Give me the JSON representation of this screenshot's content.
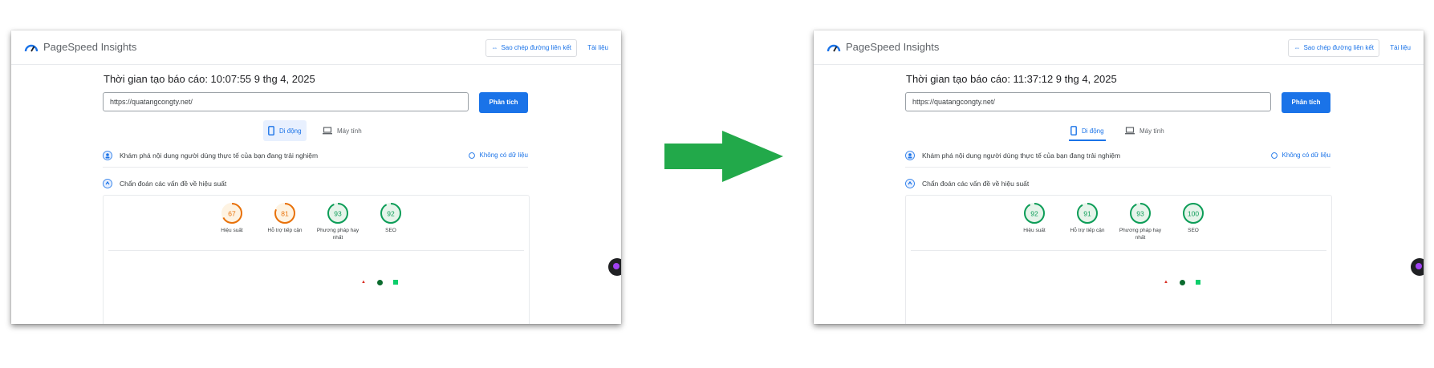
{
  "before": {
    "app_title": "PageSpeed Insights",
    "copy_link_label": "Sao chép đường liên kết",
    "docs_label": "Tài liệu",
    "report_time": "Thời gian tạo báo cáo: 10:07:55 9 thg 4, 2025",
    "url_value": "https://quatangcongty.net/",
    "analyze_label": "Phân tích",
    "tab_mobile": "Di động",
    "tab_desktop": "Máy tính",
    "crux_text": "Khám phá nội dung người dùng thực tế của bạn đang trải nghiệm",
    "nodata_label": "Không có dữ liệu",
    "diagnose_text": "Chẩn đoán các vấn đề về hiệu suất",
    "scores": [
      {
        "value": "67",
        "label": "Hiệu suất",
        "color": "#e8710a"
      },
      {
        "value": "81",
        "label": "Hỗ trợ tiếp cận",
        "color": "#e8710a"
      },
      {
        "value": "93",
        "label": "Phương pháp hay nhất",
        "color": "#0d9d58"
      },
      {
        "value": "92",
        "label": "SEO",
        "color": "#0d9d58"
      }
    ]
  },
  "after": {
    "app_title": "PageSpeed Insights",
    "copy_link_label": "Sao chép đường liên kết",
    "docs_label": "Tài liệu",
    "report_time": "Thời gian tạo báo cáo: 11:37:12 9 thg 4, 2025",
    "url_value": "https://quatangcongty.net/",
    "analyze_label": "Phân tích",
    "tab_mobile": "Di động",
    "tab_desktop": "Máy tính",
    "crux_text": "Khám phá nội dung người dùng thực tế của bạn đang trải nghiệm",
    "nodata_label": "Không có dữ liệu",
    "diagnose_text": "Chẩn đoán các vấn đề về hiệu suất",
    "scores": [
      {
        "value": "92",
        "label": "Hiệu suất",
        "color": "#0d9d58"
      },
      {
        "value": "91",
        "label": "Hỗ trợ tiếp cận",
        "color": "#0d9d58"
      },
      {
        "value": "93",
        "label": "Phương pháp hay nhất",
        "color": "#0d9d58"
      },
      {
        "value": "100",
        "label": "SEO",
        "color": "#0d9d58"
      }
    ]
  },
  "colors": {
    "accent": "#1a73e8",
    "arrow": "#22a94a",
    "pass": "#0d9d58",
    "average": "#e8710a"
  }
}
